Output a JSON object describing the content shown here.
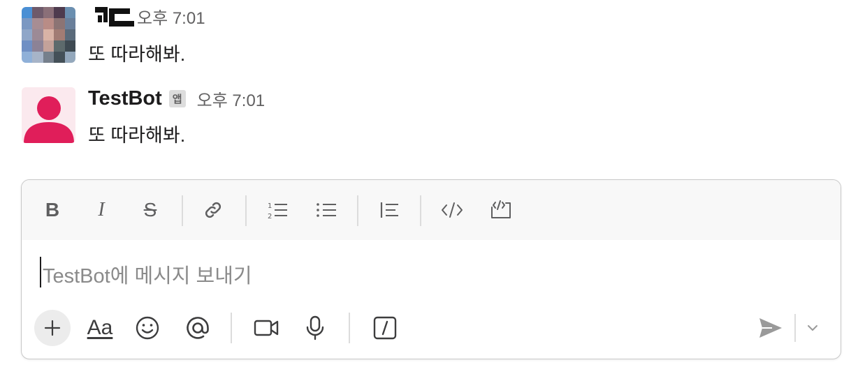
{
  "messages": [
    {
      "author": "",
      "time": "오후 7:01",
      "text": "또 따라해봐."
    },
    {
      "author": "TestBot",
      "badge": "앱",
      "time": "오후 7:01",
      "text": "또 따라해봐."
    }
  ],
  "composer": {
    "placeholder": "TestBot에 메시지 보내기",
    "format_label": "Aa",
    "bold_label": "B",
    "italic_label": "I",
    "strike_label": "S"
  },
  "colors": {
    "bot_avatar": "#e01e5a",
    "bot_avatar_bg": "#fbe9ee"
  }
}
